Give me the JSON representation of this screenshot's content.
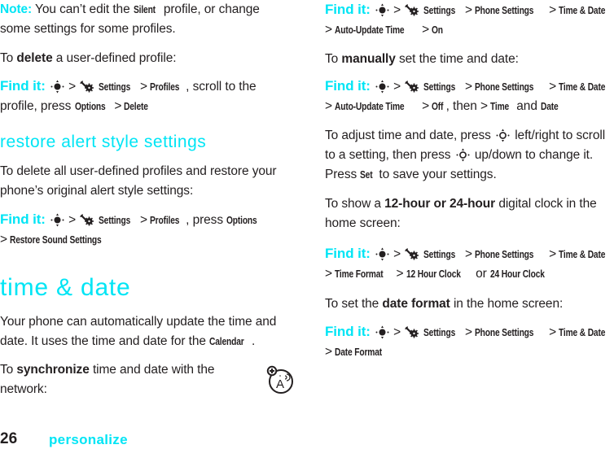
{
  "left": {
    "note": {
      "label": "Note:",
      "text1": " You can’t edit the ",
      "silent": "Silent",
      "text2": " profile, or change some settings for some profiles."
    },
    "delete_intro": {
      "pre": "To ",
      "bold": "delete",
      "post": " a user-defined profile:"
    },
    "findit1": {
      "label": "Find it:",
      "settings": "Settings",
      "profiles": "Profiles",
      "text": ", scroll to the profile, press ",
      "options": "Options",
      "delete": "Delete"
    },
    "restore_heading": "restore alert style settings",
    "restore_body": "To delete all user-defined profiles and restore your phone’s original alert style settings:",
    "findit2": {
      "label": "Find it:",
      "settings": "Settings",
      "profiles": "Profiles",
      "text": ", press ",
      "options": "Options",
      "restore": "Restore Sound Settings"
    },
    "time_heading": "time & date",
    "time_body1": "Your phone can automatically update the time and date. It uses the time and date for the ",
    "calendar": "Calendar",
    "sync_intro": {
      "pre": "To ",
      "bold": "synchronize",
      "post": " time and date with the network:"
    }
  },
  "right": {
    "findit3": {
      "label": "Find it:",
      "settings": "Settings",
      "phone_settings": "Phone Settings",
      "time_date": "Time & Date",
      "auto_update": "Auto-Update Time",
      "on": "On"
    },
    "manual_intro": {
      "pre": "To ",
      "bold": "manually",
      "post": " set the time and date:"
    },
    "findit4": {
      "label": "Find it:",
      "settings": "Settings",
      "phone_settings": "Phone Settings",
      "time_date": "Time & Date",
      "auto_update": "Auto-Update Time",
      "off": "Off",
      "then": ", then ",
      "time": "Time",
      "and": " and ",
      "date": "Date"
    },
    "adjust": {
      "t1": "To adjust time and date, press ",
      "t2": " left/right to scroll to a setting, then press ",
      "t3": " up/down to change it. Press ",
      "set": "Set",
      "t4": " to save your settings."
    },
    "clock_intro": {
      "pre": "To show a ",
      "bold": "12-hour or 24-hour",
      "post": " digital clock in the home screen:"
    },
    "findit5": {
      "label": "Find it:",
      "settings": "Settings",
      "phone_settings": "Phone Settings",
      "time_date": "Time & Date",
      "time_format": "Time Format",
      "h12": "12 Hour Clock",
      "or": " or ",
      "h24": "24 Hour Clock"
    },
    "date_intro": {
      "pre": "To set the ",
      "bold": "date format",
      "post": " in the home screen:"
    },
    "findit6": {
      "label": "Find it:",
      "settings": "Settings",
      "phone_settings": "Phone Settings",
      "time_date": "Time & Date",
      "date_format": "Date Format"
    }
  },
  "footer": {
    "page_number": "26",
    "section": "personalize"
  },
  "icons": {
    "nav": "nav-key-icon",
    "settings": "settings-icon",
    "network": "network-feature-icon"
  },
  "colors": {
    "accent": "#00e5f5",
    "text": "#231f20"
  },
  "sep": ">"
}
